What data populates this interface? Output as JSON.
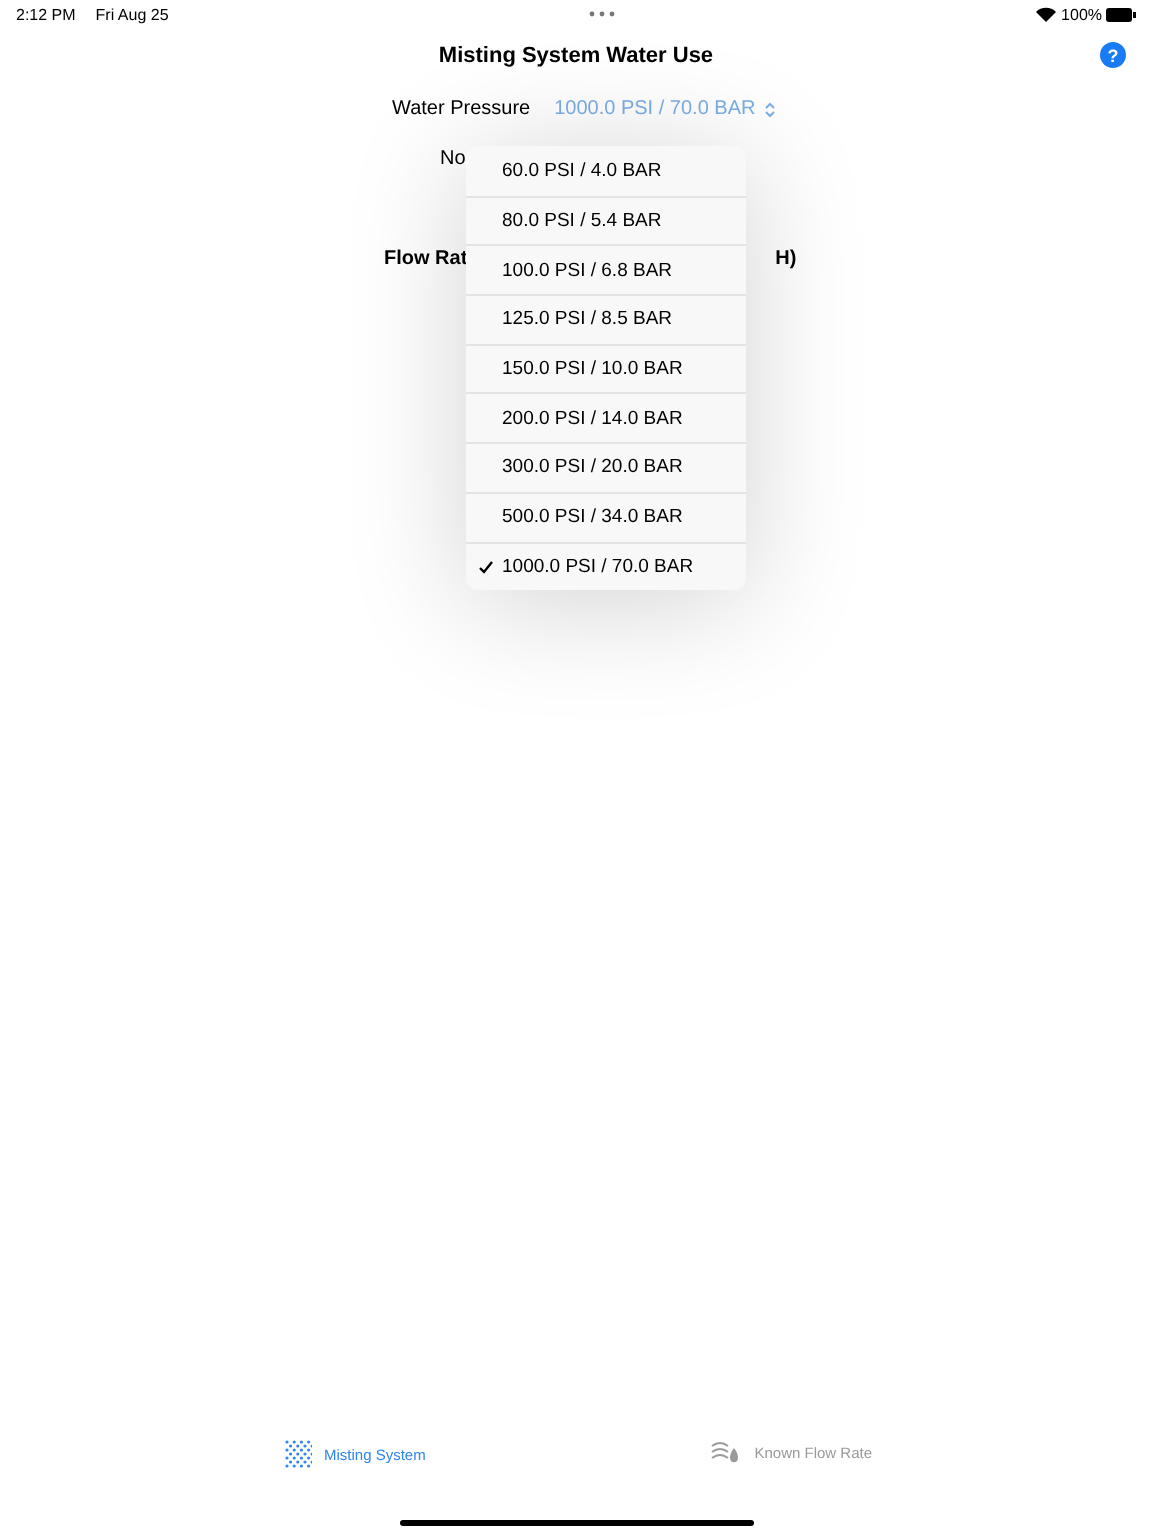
{
  "status_bar": {
    "time": "2:12 PM",
    "date": "Fri Aug 25",
    "battery": "100%"
  },
  "nav": {
    "title": "Misting System Water Use",
    "help": "?"
  },
  "form": {
    "pressure_label": "Water Pressure",
    "pressure_value": "1000.0 PSI / 70.0 BAR",
    "row_2_label": "No",
    "flow_label": "Flow Rat",
    "flow_value": "H)"
  },
  "menu": [
    {
      "label": "60.0 PSI / 4.0 BAR",
      "selected": false
    },
    {
      "label": "80.0 PSI / 5.4 BAR",
      "selected": false
    },
    {
      "label": "100.0 PSI / 6.8 BAR",
      "selected": false
    },
    {
      "label": "125.0 PSI / 8.5 BAR",
      "selected": false
    },
    {
      "label": "150.0 PSI / 10.0 BAR",
      "selected": false
    },
    {
      "label": "200.0 PSI / 14.0 BAR",
      "selected": false
    },
    {
      "label": "300.0 PSI / 20.0 BAR",
      "selected": false
    },
    {
      "label": "500.0 PSI / 34.0 BAR",
      "selected": false
    },
    {
      "label": "1000.0 PSI / 70.0 BAR",
      "selected": true
    }
  ],
  "tabs": [
    {
      "label": "Misting System",
      "kind": "mist",
      "selected": true
    },
    {
      "label": "Known Flow Rate",
      "kind": "flow",
      "selected": false
    }
  ]
}
